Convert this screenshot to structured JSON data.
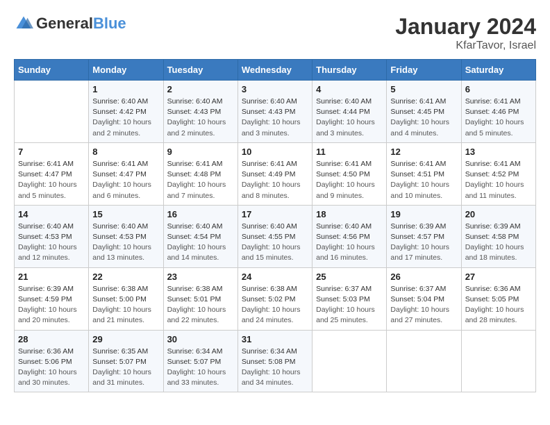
{
  "header": {
    "logo_general": "General",
    "logo_blue": "Blue",
    "month": "January 2024",
    "location": "KfarTavor, Israel"
  },
  "weekdays": [
    "Sunday",
    "Monday",
    "Tuesday",
    "Wednesday",
    "Thursday",
    "Friday",
    "Saturday"
  ],
  "weeks": [
    [
      {
        "day": "",
        "sunrise": "",
        "sunset": "",
        "daylight": ""
      },
      {
        "day": "1",
        "sunrise": "Sunrise: 6:40 AM",
        "sunset": "Sunset: 4:42 PM",
        "daylight": "Daylight: 10 hours and 2 minutes."
      },
      {
        "day": "2",
        "sunrise": "Sunrise: 6:40 AM",
        "sunset": "Sunset: 4:43 PM",
        "daylight": "Daylight: 10 hours and 2 minutes."
      },
      {
        "day": "3",
        "sunrise": "Sunrise: 6:40 AM",
        "sunset": "Sunset: 4:43 PM",
        "daylight": "Daylight: 10 hours and 3 minutes."
      },
      {
        "day": "4",
        "sunrise": "Sunrise: 6:40 AM",
        "sunset": "Sunset: 4:44 PM",
        "daylight": "Daylight: 10 hours and 3 minutes."
      },
      {
        "day": "5",
        "sunrise": "Sunrise: 6:41 AM",
        "sunset": "Sunset: 4:45 PM",
        "daylight": "Daylight: 10 hours and 4 minutes."
      },
      {
        "day": "6",
        "sunrise": "Sunrise: 6:41 AM",
        "sunset": "Sunset: 4:46 PM",
        "daylight": "Daylight: 10 hours and 5 minutes."
      }
    ],
    [
      {
        "day": "7",
        "sunrise": "Sunrise: 6:41 AM",
        "sunset": "Sunset: 4:47 PM",
        "daylight": "Daylight: 10 hours and 5 minutes."
      },
      {
        "day": "8",
        "sunrise": "Sunrise: 6:41 AM",
        "sunset": "Sunset: 4:47 PM",
        "daylight": "Daylight: 10 hours and 6 minutes."
      },
      {
        "day": "9",
        "sunrise": "Sunrise: 6:41 AM",
        "sunset": "Sunset: 4:48 PM",
        "daylight": "Daylight: 10 hours and 7 minutes."
      },
      {
        "day": "10",
        "sunrise": "Sunrise: 6:41 AM",
        "sunset": "Sunset: 4:49 PM",
        "daylight": "Daylight: 10 hours and 8 minutes."
      },
      {
        "day": "11",
        "sunrise": "Sunrise: 6:41 AM",
        "sunset": "Sunset: 4:50 PM",
        "daylight": "Daylight: 10 hours and 9 minutes."
      },
      {
        "day": "12",
        "sunrise": "Sunrise: 6:41 AM",
        "sunset": "Sunset: 4:51 PM",
        "daylight": "Daylight: 10 hours and 10 minutes."
      },
      {
        "day": "13",
        "sunrise": "Sunrise: 6:41 AM",
        "sunset": "Sunset: 4:52 PM",
        "daylight": "Daylight: 10 hours and 11 minutes."
      }
    ],
    [
      {
        "day": "14",
        "sunrise": "Sunrise: 6:40 AM",
        "sunset": "Sunset: 4:53 PM",
        "daylight": "Daylight: 10 hours and 12 minutes."
      },
      {
        "day": "15",
        "sunrise": "Sunrise: 6:40 AM",
        "sunset": "Sunset: 4:53 PM",
        "daylight": "Daylight: 10 hours and 13 minutes."
      },
      {
        "day": "16",
        "sunrise": "Sunrise: 6:40 AM",
        "sunset": "Sunset: 4:54 PM",
        "daylight": "Daylight: 10 hours and 14 minutes."
      },
      {
        "day": "17",
        "sunrise": "Sunrise: 6:40 AM",
        "sunset": "Sunset: 4:55 PM",
        "daylight": "Daylight: 10 hours and 15 minutes."
      },
      {
        "day": "18",
        "sunrise": "Sunrise: 6:40 AM",
        "sunset": "Sunset: 4:56 PM",
        "daylight": "Daylight: 10 hours and 16 minutes."
      },
      {
        "day": "19",
        "sunrise": "Sunrise: 6:39 AM",
        "sunset": "Sunset: 4:57 PM",
        "daylight": "Daylight: 10 hours and 17 minutes."
      },
      {
        "day": "20",
        "sunrise": "Sunrise: 6:39 AM",
        "sunset": "Sunset: 4:58 PM",
        "daylight": "Daylight: 10 hours and 18 minutes."
      }
    ],
    [
      {
        "day": "21",
        "sunrise": "Sunrise: 6:39 AM",
        "sunset": "Sunset: 4:59 PM",
        "daylight": "Daylight: 10 hours and 20 minutes."
      },
      {
        "day": "22",
        "sunrise": "Sunrise: 6:38 AM",
        "sunset": "Sunset: 5:00 PM",
        "daylight": "Daylight: 10 hours and 21 minutes."
      },
      {
        "day": "23",
        "sunrise": "Sunrise: 6:38 AM",
        "sunset": "Sunset: 5:01 PM",
        "daylight": "Daylight: 10 hours and 22 minutes."
      },
      {
        "day": "24",
        "sunrise": "Sunrise: 6:38 AM",
        "sunset": "Sunset: 5:02 PM",
        "daylight": "Daylight: 10 hours and 24 minutes."
      },
      {
        "day": "25",
        "sunrise": "Sunrise: 6:37 AM",
        "sunset": "Sunset: 5:03 PM",
        "daylight": "Daylight: 10 hours and 25 minutes."
      },
      {
        "day": "26",
        "sunrise": "Sunrise: 6:37 AM",
        "sunset": "Sunset: 5:04 PM",
        "daylight": "Daylight: 10 hours and 27 minutes."
      },
      {
        "day": "27",
        "sunrise": "Sunrise: 6:36 AM",
        "sunset": "Sunset: 5:05 PM",
        "daylight": "Daylight: 10 hours and 28 minutes."
      }
    ],
    [
      {
        "day": "28",
        "sunrise": "Sunrise: 6:36 AM",
        "sunset": "Sunset: 5:06 PM",
        "daylight": "Daylight: 10 hours and 30 minutes."
      },
      {
        "day": "29",
        "sunrise": "Sunrise: 6:35 AM",
        "sunset": "Sunset: 5:07 PM",
        "daylight": "Daylight: 10 hours and 31 minutes."
      },
      {
        "day": "30",
        "sunrise": "Sunrise: 6:34 AM",
        "sunset": "Sunset: 5:07 PM",
        "daylight": "Daylight: 10 hours and 33 minutes."
      },
      {
        "day": "31",
        "sunrise": "Sunrise: 6:34 AM",
        "sunset": "Sunset: 5:08 PM",
        "daylight": "Daylight: 10 hours and 34 minutes."
      },
      {
        "day": "",
        "sunrise": "",
        "sunset": "",
        "daylight": ""
      },
      {
        "day": "",
        "sunrise": "",
        "sunset": "",
        "daylight": ""
      },
      {
        "day": "",
        "sunrise": "",
        "sunset": "",
        "daylight": ""
      }
    ]
  ]
}
